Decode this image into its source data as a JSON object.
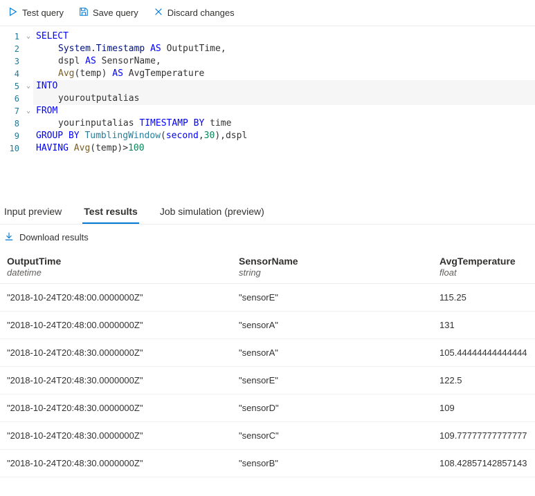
{
  "toolbar": {
    "test_label": "Test query",
    "save_label": "Save query",
    "discard_label": "Discard changes"
  },
  "tabs": {
    "input_preview": "Input preview",
    "test_results": "Test results",
    "job_simulation": "Job simulation (preview)"
  },
  "download_label": "Download results",
  "code": {
    "l1": "SELECT",
    "l2_a": "System",
    "l2_b": "Timestamp",
    "l2_as": "AS",
    "l2_c": "OutputTime",
    "l3_a": "dspl",
    "l3_as": "AS",
    "l3_b": "SensorName",
    "l4_fn": "Avg",
    "l4_arg": "temp",
    "l4_as": "AS",
    "l4_out": "AvgTemperature",
    "l5": "INTO",
    "l6": "youroutputalias",
    "l7": "FROM",
    "l8_a": "yourinputalias",
    "l8_b": "TIMESTAMP BY",
    "l8_c": "time",
    "l9_a": "GROUP BY",
    "l9_fn": "TumblingWindow",
    "l9_arg1": "second",
    "l9_arg2": "30",
    "l9_tail": "dspl",
    "l10_a": "HAVING",
    "l10_fn": "Avg",
    "l10_arg": "temp",
    "l10_op": ">",
    "l10_val": "100"
  },
  "columns": [
    {
      "name": "OutputTime",
      "type": "datetime"
    },
    {
      "name": "SensorName",
      "type": "string"
    },
    {
      "name": "AvgTemperature",
      "type": "float"
    }
  ],
  "rows": [
    {
      "c0": "\"2018-10-24T20:48:00.0000000Z\"",
      "c1": "\"sensorE\"",
      "c2": "115.25"
    },
    {
      "c0": "\"2018-10-24T20:48:00.0000000Z\"",
      "c1": "\"sensorA\"",
      "c2": "131"
    },
    {
      "c0": "\"2018-10-24T20:48:30.0000000Z\"",
      "c1": "\"sensorA\"",
      "c2": "105.44444444444444"
    },
    {
      "c0": "\"2018-10-24T20:48:30.0000000Z\"",
      "c1": "\"sensorE\"",
      "c2": "122.5"
    },
    {
      "c0": "\"2018-10-24T20:48:30.0000000Z\"",
      "c1": "\"sensorD\"",
      "c2": "109"
    },
    {
      "c0": "\"2018-10-24T20:48:30.0000000Z\"",
      "c1": "\"sensorC\"",
      "c2": "109.77777777777777"
    },
    {
      "c0": "\"2018-10-24T20:48:30.0000000Z\"",
      "c1": "\"sensorB\"",
      "c2": "108.42857142857143"
    }
  ]
}
